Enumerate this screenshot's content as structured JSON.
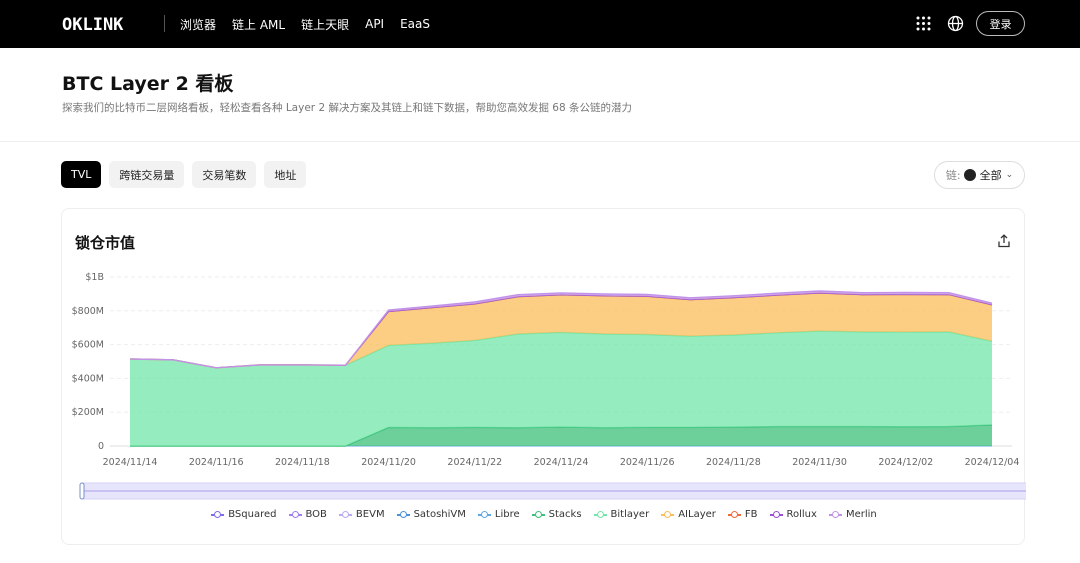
{
  "nav": {
    "logo": "OKLINK",
    "links": [
      "浏览器",
      "链上 AML",
      "链上天眼",
      "API",
      "EaaS"
    ],
    "login": "登录"
  },
  "header": {
    "title": "BTC Layer 2 看板",
    "description": "探索我们的比特币二层网络看板，轻松查看各种 Layer 2 解决方案及其链上和链下数据，帮助您高效发掘 68 条公链的潜力"
  },
  "tabs": [
    {
      "label": "TVL",
      "active": true
    },
    {
      "label": "跨链交易量",
      "active": false
    },
    {
      "label": "交易笔数",
      "active": false
    },
    {
      "label": "地址",
      "active": false
    }
  ],
  "chain_filter": {
    "label": "链:",
    "value": "全部"
  },
  "card": {
    "title": "锁仓市值"
  },
  "chart_data": {
    "type": "area",
    "stacked": true,
    "title": "锁仓市值",
    "x": [
      "2024/11/14",
      "2024/11/15",
      "2024/11/16",
      "2024/11/17",
      "2024/11/18",
      "2024/11/19",
      "2024/11/20",
      "2024/11/21",
      "2024/11/22",
      "2024/11/23",
      "2024/11/24",
      "2024/11/25",
      "2024/11/26",
      "2024/11/27",
      "2024/11/28",
      "2024/11/29",
      "2024/11/30",
      "2024/12/01",
      "2024/12/02",
      "2024/12/03",
      "2024/12/04"
    ],
    "x_tick_labels": [
      "2024/11/14",
      "2024/11/16",
      "2024/11/18",
      "2024/11/20",
      "2024/11/22",
      "2024/11/24",
      "2024/11/26",
      "2024/11/28",
      "2024/11/30",
      "2024/12/02",
      "2024/12/04"
    ],
    "y_tick_labels": [
      "0",
      "$200M",
      "$400M",
      "$600M",
      "$800M",
      "$1B"
    ],
    "ylim": [
      0,
      1000
    ],
    "y_unit": "M",
    "grid": true,
    "legend_position": "bottom",
    "series": [
      {
        "name": "BSquared",
        "color": "#7b6ee8",
        "values": [
          0,
          0,
          0,
          0,
          0,
          0,
          0,
          0,
          0,
          0,
          0,
          0,
          0,
          0,
          0,
          0,
          0,
          0,
          0,
          0,
          0
        ]
      },
      {
        "name": "BOB",
        "color": "#a07df0",
        "values": [
          0,
          0,
          0,
          0,
          0,
          0,
          0,
          0,
          0,
          0,
          0,
          0,
          0,
          0,
          0,
          0,
          0,
          0,
          0,
          0,
          0
        ]
      },
      {
        "name": "BEVM",
        "color": "#b9a8f2",
        "values": [
          0,
          0,
          0,
          0,
          0,
          0,
          0,
          0,
          0,
          0,
          0,
          0,
          0,
          0,
          0,
          0,
          0,
          0,
          0,
          0,
          0
        ]
      },
      {
        "name": "SatoshiVM",
        "color": "#4a8fd8",
        "values": [
          0,
          0,
          0,
          0,
          0,
          0,
          0,
          0,
          0,
          0,
          0,
          0,
          0,
          0,
          0,
          0,
          0,
          0,
          0,
          0,
          0
        ]
      },
      {
        "name": "Libre",
        "color": "#5fa8e8",
        "values": [
          0,
          0,
          0,
          0,
          0,
          0,
          0,
          0,
          0,
          0,
          0,
          0,
          0,
          0,
          0,
          0,
          0,
          0,
          0,
          0,
          0
        ]
      },
      {
        "name": "Stacks",
        "color": "#3cc07a",
        "values": [
          0,
          0,
          0,
          0,
          0,
          0,
          110,
          108,
          110,
          108,
          112,
          108,
          110,
          110,
          112,
          115,
          115,
          115,
          114,
          115,
          125
        ]
      },
      {
        "name": "Bitlayer",
        "color": "#72e6a8",
        "values": [
          515,
          510,
          463,
          480,
          480,
          478,
          485,
          500,
          515,
          555,
          560,
          555,
          550,
          540,
          545,
          555,
          565,
          560,
          560,
          560,
          495
        ]
      },
      {
        "name": "AILayer",
        "color": "#fbbd5a",
        "values": [
          0,
          0,
          0,
          0,
          0,
          0,
          200,
          210,
          215,
          220,
          222,
          225,
          225,
          215,
          220,
          222,
          225,
          220,
          222,
          220,
          215
        ]
      },
      {
        "name": "FB",
        "color": "#f06a3b",
        "values": [
          0,
          0,
          0,
          0,
          0,
          0,
          0,
          0,
          0,
          0,
          0,
          0,
          0,
          0,
          0,
          0,
          0,
          0,
          0,
          0,
          0
        ]
      },
      {
        "name": "Rollux",
        "color": "#9b4fd4",
        "values": [
          0,
          0,
          0,
          0,
          0,
          0,
          0,
          0,
          0,
          0,
          0,
          0,
          0,
          0,
          0,
          0,
          0,
          0,
          0,
          0,
          0
        ]
      },
      {
        "name": "Merlin",
        "color": "#c292e8",
        "values": [
          0,
          0,
          0,
          0,
          0,
          0,
          10,
          10,
          12,
          12,
          12,
          12,
          12,
          12,
          12,
          12,
          12,
          12,
          12,
          12,
          10
        ]
      }
    ]
  }
}
